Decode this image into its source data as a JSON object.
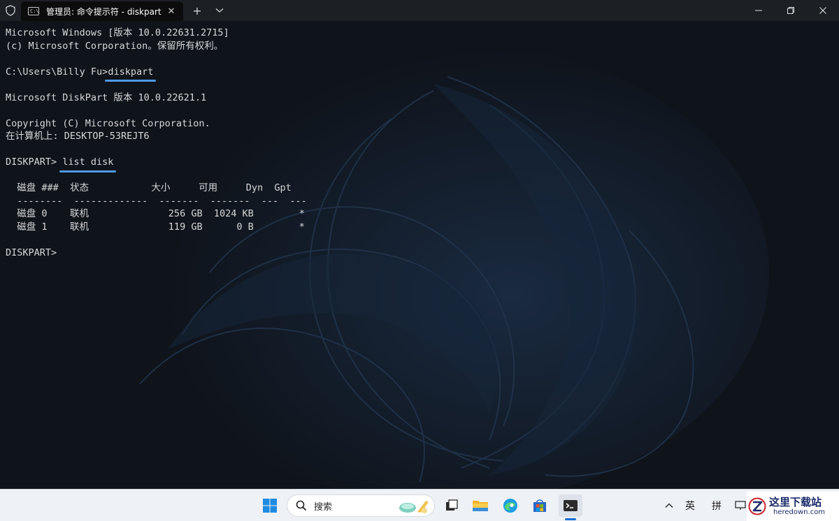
{
  "titlebar": {
    "tab_title": "管理员: 命令提示符 - diskpart",
    "tab_icon_text": "C:\\",
    "close_tab_glyph": "✕",
    "new_tab_glyph": "+",
    "dropdown_glyph": "⌄",
    "minimize_glyph": "─",
    "maximize_glyph": "❐",
    "close_glyph": "✕"
  },
  "terminal": {
    "lines": [
      "Microsoft Windows [版本 10.0.22631.2715]",
      "(c) Microsoft Corporation。保留所有权利。",
      "",
      "",
      "",
      "Microsoft DiskPart 版本 10.0.22621.1",
      "",
      "Copyright (C) Microsoft Corporation.",
      "在计算机上: DESKTOP-53REJT6",
      "",
      "",
      "",
      "  磁盘 ###  状态           大小     可用     Dyn  Gpt",
      "  --------  -------------  -------  -------  ---  ---",
      "  磁盘 0    联机              256 GB  1024 KB        *",
      "  磁盘 1    联机              119 GB      0 B        *",
      "",
      "DISKPART> "
    ],
    "prompt1": "C:\\Users\\Billy Fu>",
    "command1": "diskpart",
    "prompt2": "DISKPART> ",
    "command2": "list disk"
  },
  "taskbar": {
    "search_label": "搜索",
    "tray_chevron": "∧",
    "ime_language": "英",
    "ime_mode": "拼"
  },
  "watermark": {
    "cn": "这里下载站",
    "en": "heredown.com",
    "logo_letter": "Z"
  },
  "colors": {
    "terminal_text": "#d8d8d8",
    "underline_accent": "#4f9ae6",
    "taskbar_bg": "#eef1f6",
    "titlebar_bg": "#1c1f24"
  }
}
